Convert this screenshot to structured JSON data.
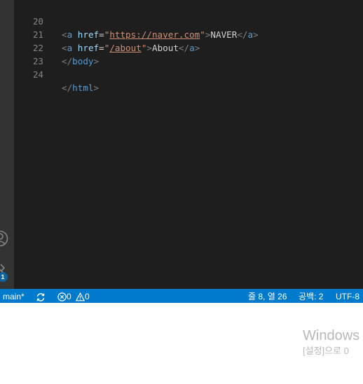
{
  "editor": {
    "lines": [
      {
        "number": "20",
        "tag_open": "<",
        "tag": "a",
        "attr": "href",
        "eq": "=",
        "quote": "\"",
        "href": "https://naver.com",
        "tag_end": ">",
        "text": "NAVER",
        "close_open": "</",
        "close_tag": "a",
        "close_end": ">"
      },
      {
        "number": "21",
        "tag_open": "<",
        "tag": "a",
        "attr": "href",
        "eq": "=",
        "quote": "\"",
        "href": "/about",
        "tag_end": ">",
        "text": "About",
        "close_open": "</",
        "close_tag": "a",
        "close_end": ">"
      },
      {
        "number": "22",
        "close_open": "</",
        "close_tag": "body",
        "close_end": ">"
      },
      {
        "number": "23"
      },
      {
        "number": "24",
        "close_open": "</",
        "close_tag": "html",
        "close_end": ">"
      }
    ]
  },
  "activity_bar": {
    "icons": [
      "account-icon",
      "extensions-icon"
    ],
    "badge": "1"
  },
  "statusbar": {
    "branch": "main*",
    "errors": "0",
    "warnings": "0",
    "cursor_position": "줄 8, 열 26",
    "indentation": "공백: 2",
    "encoding": "UTF-8"
  },
  "watermark": {
    "title": "Windows",
    "subtitle": "[설정]으로 0"
  },
  "colors": {
    "editor_bg": "#1e1e1e",
    "statusbar_bg": "#007acc",
    "tag": "#569cd6",
    "attribute": "#9cdcfe",
    "string": "#ce9178",
    "line_number": "#858585"
  }
}
